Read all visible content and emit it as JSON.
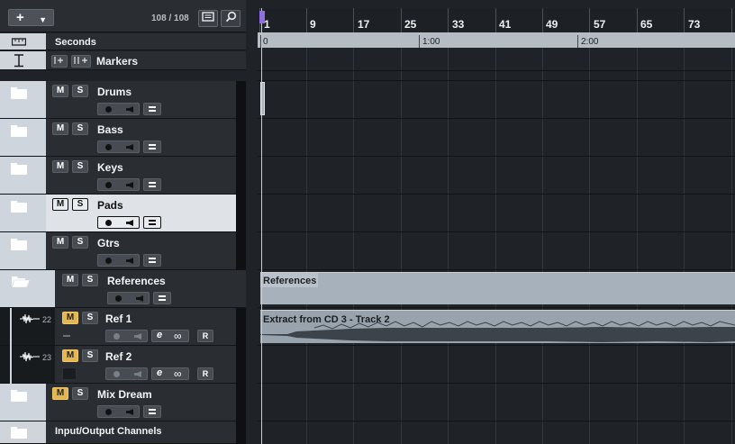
{
  "toolbar": {
    "add_label": "+",
    "track_count": "108 / 108"
  },
  "rows": {
    "seconds_label": "Seconds",
    "markers_label": "Markers",
    "io_label": "Input/Output Channels"
  },
  "tracks": [
    {
      "name": "Drums",
      "mute": "M",
      "solo": "S"
    },
    {
      "name": "Bass",
      "mute": "M",
      "solo": "S"
    },
    {
      "name": "Keys",
      "mute": "M",
      "solo": "S"
    },
    {
      "name": "Pads",
      "mute": "M",
      "solo": "S"
    },
    {
      "name": "Gtrs",
      "mute": "M",
      "solo": "S"
    },
    {
      "name": "References",
      "mute": "M",
      "solo": "S"
    },
    {
      "name": "Ref 1",
      "number": "22",
      "mute": "M",
      "solo": "S",
      "read": "R"
    },
    {
      "name": "Ref 2",
      "number": "23",
      "mute": "M",
      "solo": "S",
      "read": "R"
    },
    {
      "name": "Mix Dream",
      "mute": "M",
      "solo": "S"
    }
  ],
  "ruler": {
    "bars": [
      "1",
      "9",
      "17",
      "25",
      "33",
      "41",
      "49",
      "57",
      "65",
      "73"
    ],
    "time_labels": [
      "0",
      "1:00",
      "2:00"
    ]
  },
  "clips": {
    "references_title": "References",
    "audio_title": "Extract from CD 3 - Track 2"
  },
  "colors": {
    "mute_active": "#e3b652",
    "playhead": "#8f6fe0",
    "clip": "#98a3ae",
    "selected_track": "#dfe2e6"
  },
  "icons": [
    "add-icon",
    "chevron-down-icon",
    "list-icon",
    "search-icon",
    "ruler-icon",
    "marker-icon",
    "folder-icon",
    "folder-open-icon",
    "waveform-icon",
    "record-icon",
    "speaker-icon",
    "lanes-icon",
    "edit-icon",
    "link-icon"
  ]
}
